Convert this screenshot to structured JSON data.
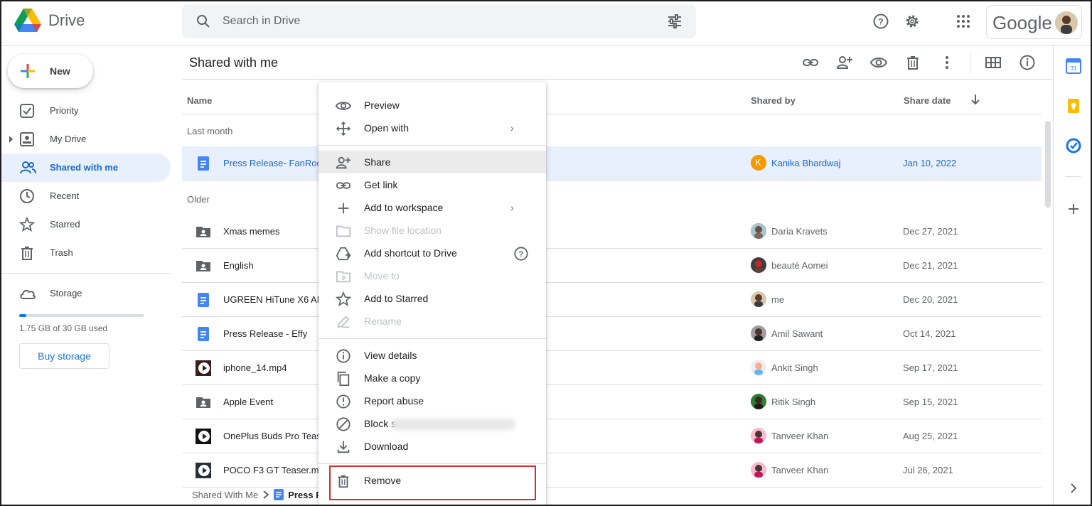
{
  "app": {
    "title": "Drive"
  },
  "search": {
    "placeholder": "Search in Drive"
  },
  "account": {
    "brand": "Google"
  },
  "sidebar": {
    "new_label": "New",
    "items": [
      {
        "label": "Priority",
        "icon": "priority-icon"
      },
      {
        "label": "My Drive",
        "icon": "my-drive-icon"
      },
      {
        "label": "Shared with me",
        "icon": "shared-icon",
        "active": true
      },
      {
        "label": "Recent",
        "icon": "clock-icon"
      },
      {
        "label": "Starred",
        "icon": "star-icon"
      },
      {
        "label": "Trash",
        "icon": "trash-icon"
      }
    ],
    "storage_label": "Storage",
    "storage_used": "1.75 GB of 30 GB used",
    "storage_fraction": 0.058,
    "buy_label": "Buy storage"
  },
  "main": {
    "title": "Shared with me",
    "columns": {
      "name": "Name",
      "shared_by": "Shared by",
      "share_date": "Share date"
    },
    "sections": {
      "last_month": "Last month",
      "older": "Older"
    }
  },
  "files": [
    {
      "name": "Press Release- FanRoom",
      "type": "doc",
      "shared_by": "Kanika Bhardwaj",
      "avatar_letter": "K",
      "date": "Jan 10, 2022",
      "selected": true
    },
    {
      "name": "Xmas memes",
      "type": "shared-folder",
      "shared_by": "Daria Kravets",
      "date": "Dec 27, 2021"
    },
    {
      "name": "English",
      "type": "shared-folder",
      "shared_by": "beauté Aomei",
      "date": "Dec 21, 2021"
    },
    {
      "name": "UGREEN HiTune X6 ANC",
      "type": "doc",
      "shared_by": "me",
      "date": "Dec 20, 2021"
    },
    {
      "name": "Press Release - Effy",
      "type": "doc",
      "shared_by": "Amil Sawant",
      "date": "Oct 14, 2021"
    },
    {
      "name": "iphone_14.mp4",
      "type": "video",
      "shared_by": "Ankit Singh",
      "date": "Sep 17, 2021"
    },
    {
      "name": "Apple Event",
      "type": "shared-folder",
      "shared_by": "Ritik Singh",
      "date": "Sep 15, 2021"
    },
    {
      "name": "OnePlus Buds Pro Teaser",
      "type": "video",
      "shared_by": "Tanveer Khan",
      "date": "Aug 25, 2021"
    },
    {
      "name": "POCO F3 GT Teaser.m4",
      "type": "video",
      "shared_by": "Tanveer Khan",
      "date": "Jul 26, 2021"
    }
  ],
  "breadcrumb": {
    "root": "Shared With Me",
    "current": "Press R"
  },
  "context_menu": {
    "items": [
      {
        "label": "Preview",
        "icon": "eye-icon"
      },
      {
        "label": "Open with",
        "icon": "open-with-icon",
        "submenu": true
      },
      {
        "label": "Share",
        "icon": "add-person-icon",
        "hover": true
      },
      {
        "label": "Get link",
        "icon": "link-icon"
      },
      {
        "label": "Add to workspace",
        "icon": "plus-icon",
        "submenu": true
      },
      {
        "label": "Show file location",
        "icon": "folder-icon",
        "disabled": true
      },
      {
        "label": "Add shortcut to Drive",
        "icon": "shortcut-icon",
        "help": true
      },
      {
        "label": "Move to",
        "icon": "move-icon",
        "disabled": true
      },
      {
        "label": "Add to Starred",
        "icon": "star-icon"
      },
      {
        "label": "Rename",
        "icon": "pencil-icon",
        "disabled": true
      },
      {
        "label": "View details",
        "icon": "info-icon"
      },
      {
        "label": "Make a copy",
        "icon": "copy-icon"
      },
      {
        "label": "Report abuse",
        "icon": "report-icon"
      },
      {
        "label": "Block s",
        "icon": "block-icon"
      },
      {
        "label": "Download",
        "icon": "download-icon"
      },
      {
        "label": "Remove",
        "icon": "trash-icon",
        "highlighted": true
      }
    ],
    "arrow": "›"
  },
  "colors": {
    "accent": "#1a73e8",
    "selected_bg": "#e8f0fe",
    "highlight_box": "#d32f2f"
  }
}
